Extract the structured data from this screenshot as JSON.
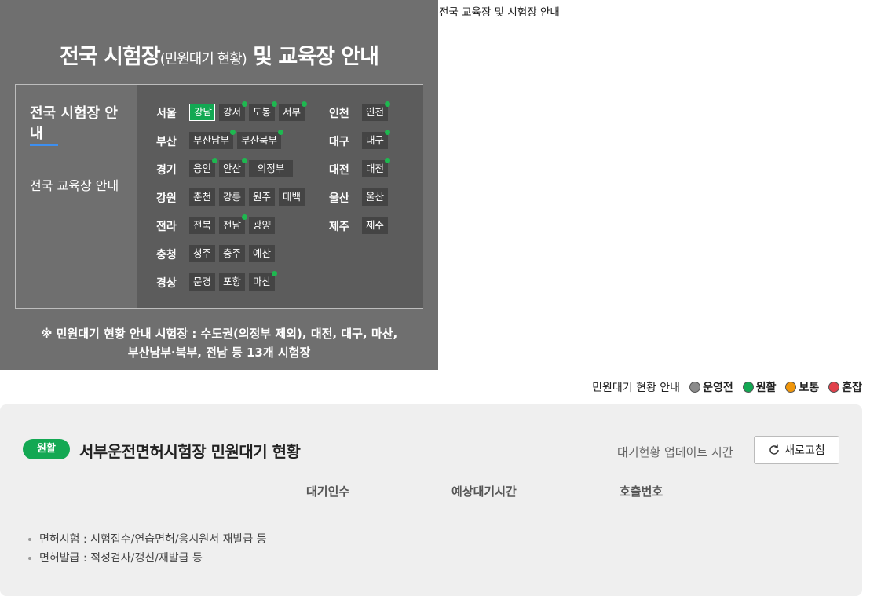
{
  "page_heading": "전국 교육장 및 시험장 안내",
  "panel": {
    "title_main": "전국 시험장",
    "title_sub": "(민원대기 현황)",
    "title_rest": "및 교육장 안내",
    "nav": [
      "전국 시험장 안내",
      "전국 교육장 안내"
    ],
    "note_line1": "※ 민원대기 현황 안내 시험장 : 수도권(의정부 제외), 대전, 대구, 마산,",
    "note_line2": "부산남부·북부, 전남 등 13개 시험장"
  },
  "regions": [
    {
      "name": "서울",
      "centers": [
        {
          "label": "강남",
          "dot": false,
          "active": true
        },
        {
          "label": "강서",
          "dot": true
        },
        {
          "label": "도봉",
          "dot": true
        },
        {
          "label": "서부",
          "dot": true
        }
      ]
    },
    {
      "name": "부산",
      "centers": [
        {
          "label": "부산남부",
          "dot": true
        },
        {
          "label": "부산북부",
          "dot": true
        }
      ]
    },
    {
      "name": "경기",
      "centers": [
        {
          "label": "용인",
          "dot": true
        },
        {
          "label": "안산",
          "dot": true
        },
        {
          "label": "의정부",
          "dot": false
        }
      ]
    },
    {
      "name": "강원",
      "centers": [
        {
          "label": "춘천",
          "dot": false
        },
        {
          "label": "강릉",
          "dot": false
        },
        {
          "label": "원주",
          "dot": false
        },
        {
          "label": "태백",
          "dot": false
        }
      ]
    },
    {
      "name": "전라",
      "centers": [
        {
          "label": "전북",
          "dot": false
        },
        {
          "label": "전남",
          "dot": true
        },
        {
          "label": "광양",
          "dot": false
        }
      ]
    },
    {
      "name": "충청",
      "centers": [
        {
          "label": "청주",
          "dot": false
        },
        {
          "label": "충주",
          "dot": false
        },
        {
          "label": "예산",
          "dot": false
        }
      ]
    },
    {
      "name": "경상",
      "centers": [
        {
          "label": "문경",
          "dot": false
        },
        {
          "label": "포항",
          "dot": false
        },
        {
          "label": "마산",
          "dot": true
        }
      ]
    },
    {
      "name": "인천",
      "centers": [
        {
          "label": "인천",
          "dot": true
        }
      ]
    },
    {
      "name": "대구",
      "centers": [
        {
          "label": "대구",
          "dot": true
        }
      ]
    },
    {
      "name": "대전",
      "centers": [
        {
          "label": "대전",
          "dot": true
        }
      ]
    },
    {
      "name": "울산",
      "centers": [
        {
          "label": "울산",
          "dot": false
        }
      ]
    },
    {
      "name": "제주",
      "centers": [
        {
          "label": "제주",
          "dot": false
        }
      ]
    }
  ],
  "legend": {
    "label": "민원대기 현황 안내",
    "items": [
      {
        "label": "운영전",
        "color": "#8a8a8a"
      },
      {
        "label": "원활",
        "color": "#13a853"
      },
      {
        "label": "보통",
        "color": "#f0960a"
      },
      {
        "label": "혼잡",
        "color": "#e0414b"
      }
    ]
  },
  "status_card": {
    "badge": "원활",
    "title": "서부운전면허시험장 민원대기 현황",
    "update_label": "대기현황 업데이트 시간",
    "refresh_label": "새로고침",
    "columns": [
      "대기인수",
      "예상대기시간",
      "호출번호"
    ],
    "bullets": [
      "면허시험 : 시험접수/연습면허/응시원서 재발급 등",
      "면허발급 : 적성검사/갱신/재발급 등"
    ]
  }
}
